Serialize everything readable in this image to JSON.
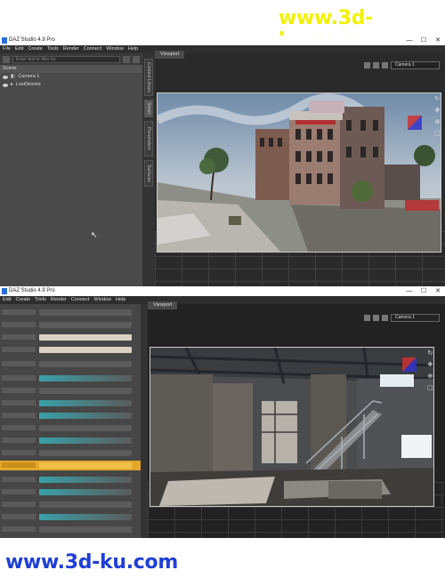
{
  "watermark": {
    "text": "www.3d-ku.com",
    "top_color": "#f2f200",
    "bottom_color": "#1f3fd6"
  },
  "app1": {
    "title": "DAZ Studio 4.9 Pro",
    "menu": [
      "File",
      "Edit",
      "Create",
      "Tools",
      "Render",
      "Connect",
      "Window",
      "Help"
    ],
    "search_placeholder": "Enter text to filter by",
    "scene_label": "Scene",
    "scene_items": [
      "Camera 1",
      "LostStreets"
    ],
    "side_tabs": [
      "Content Library",
      "Smart",
      "Parameters",
      "Surfaces"
    ],
    "viewport_tab": "Viewport",
    "camera_select": "Camera 1"
  },
  "app2": {
    "title": "DAZ Studio 4.9 Pro",
    "menu": [
      "Edit",
      "Create",
      "Tools",
      "Render",
      "Connect",
      "Window",
      "Help"
    ],
    "viewport_tab": "Viewport",
    "camera_select": "Camera 1"
  },
  "icons": {
    "nav_cube": "navigation-cube-icon",
    "rotate": "rotate-icon",
    "pan": "pan-icon",
    "zoom": "zoom-icon",
    "camera": "camera-icon"
  }
}
